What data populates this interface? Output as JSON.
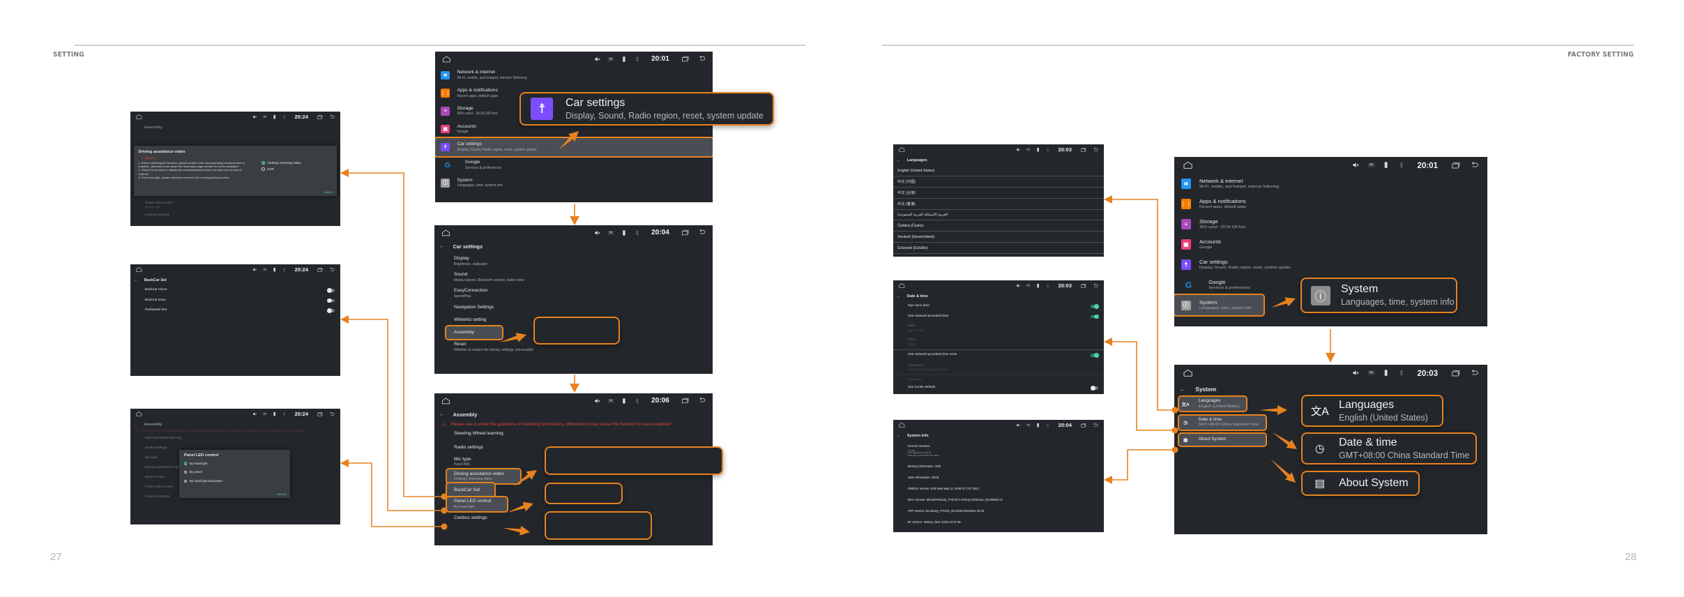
{
  "page_left": {
    "section": "SETTING",
    "page_number": "27"
  },
  "page_right": {
    "section": "FACTORY SETTING",
    "page_number": "28"
  },
  "accent_color": "#e8821e",
  "settings_items": [
    {
      "title": "Network & internet",
      "subtitle": "Wi-Fi, mobile, and hotspot, internet Tethering",
      "icon": "wifi-icon",
      "color": "#2196f3"
    },
    {
      "title": "Apps & notifications",
      "subtitle": "Recent apps, default apps",
      "icon": "apps-grid-icon",
      "color": "#f57c00"
    },
    {
      "title": "Storage",
      "subtitle": "36% used - 20.55 GB free",
      "icon": "storage-icon",
      "color": "#ab47bc"
    },
    {
      "title": "Accounts",
      "subtitle": "Google",
      "icon": "account-icon",
      "color": "#ec407a"
    },
    {
      "title": "Car settings",
      "subtitle": "Display, Sound, Radio region, reset, system update",
      "icon": "accessibility-icon",
      "color": "#7c4dff"
    },
    {
      "title": "Google",
      "subtitle": "Services & preferences",
      "icon": "google-icon",
      "color": "#1e88e5"
    },
    {
      "title": "System",
      "subtitle": "Languages, time, system info",
      "icon": "info-icon",
      "color": "#9e9e9e"
    }
  ],
  "screens": {
    "main_left": {
      "time": "20:01"
    },
    "car_settings": {
      "time": "20:04",
      "title": "Car settings",
      "items": [
        {
          "title": "Display",
          "subtitle": "Brightness, wallpaper"
        },
        {
          "title": "Sound",
          "subtitle": "Media volume, Bluetooth volume, button tone"
        },
        {
          "title": "EasyConnection",
          "subtitle": "SpeedPlay"
        },
        {
          "title": "Navigation Settings",
          "subtitle": ""
        },
        {
          "title": "Whitelist setting",
          "subtitle": ""
        },
        {
          "title": "Assembly",
          "subtitle": ""
        },
        {
          "title": "Reset",
          "subtitle": "Whether to restore the factory settings, irrevocable!"
        }
      ]
    },
    "assembly": {
      "time": "20:06",
      "title": "Assembly",
      "warning": "Please use it under the guidance of installing technicians, otherwise it may cause the function to use exception!",
      "items": [
        {
          "title": "Steering Wheel learning",
          "subtitle": ""
        },
        {
          "title": "Radio settings",
          "subtitle": ""
        },
        {
          "title": "Mic type",
          "subtitle": "Panel MIC"
        },
        {
          "title": "Driving assistance video",
          "subtitle": "Ordinary reversing video"
        },
        {
          "title": "BackCar Set",
          "subtitle": ""
        },
        {
          "title": "Panel LED control",
          "subtitle": "By head light"
        },
        {
          "title": "Canbus settings",
          "subtitle": ""
        }
      ]
    },
    "driving_video": {
      "time": "20:24",
      "bg_title": "Assembly",
      "bg_items": [
        {
          "title": "Panel LED control",
          "subtitle": "By head light"
        },
        {
          "title": "Canbus settings",
          "subtitle": ""
        }
      ],
      "dialog_title": "Driving assistance video",
      "warning_label": "Warning",
      "lines": [
        "1. Before selecting the function, please confirm if the corresponding functional item is installed, otherwise it will cause the reversing image function to not be available!",
        "2. Select the function to display the corresponding function icon after the function is entered.",
        "3. If the lens type, please select the screen in the corresponding function."
      ],
      "options": [
        {
          "label": "Ordinary reversing video",
          "selected": true
        },
        {
          "label": "DVR",
          "selected": false
        }
      ],
      "cancel": "CANCEL"
    },
    "backcar": {
      "time": "20:24",
      "title": "BackCar Set",
      "toggles": [
        {
          "label": "Backcar mirror",
          "on": false
        },
        {
          "label": "Backcar trace",
          "on": false
        },
        {
          "label": "Parkassist line",
          "on": false
        }
      ]
    },
    "panel_led": {
      "time": "20:24",
      "bg_title": "Assembly",
      "bg_items": [
        "Steering Wheel learning",
        "Radio settings",
        "Mic type",
        "Driving assistance video",
        "BackCar Set",
        "Panel LED control",
        "Canbus settings"
      ],
      "dialog_title": "Panel LED control",
      "options": [
        {
          "label": "By head light",
          "selected": true
        },
        {
          "label": "By power",
          "selected": false
        },
        {
          "label": "By head light and power",
          "selected": false
        }
      ],
      "cancel": "CANCEL"
    },
    "languages": {
      "time": "20:03",
      "title": "Languages",
      "items": [
        "English (United States)",
        "中文 (中国)",
        "中文 (台灣)",
        "中文 (香港)",
        "العربية (المملكة العربية السعودية)",
        "Čeština (Česko)",
        "Deutsch (Deutschland)",
        "Ελληνικά (Ελλάδα)"
      ]
    },
    "date_time": {
      "time": "20:03",
      "title": "Date & time",
      "rows": [
        {
          "title": "Gps sync time",
          "subtitle": "",
          "toggle": "on",
          "dim": false
        },
        {
          "title": "Use network-provided time",
          "subtitle": "",
          "toggle": "on",
          "dim": false
        },
        {
          "title": "Date",
          "subtitle": "May 11, 2022",
          "toggle": "",
          "dim": true
        },
        {
          "title": "Time",
          "subtitle": "20:03",
          "toggle": "",
          "dim": true
        },
        {
          "title": "Use network-provided time zone",
          "subtitle": "",
          "toggle": "on",
          "dim": false
        },
        {
          "title": "Time zone",
          "subtitle": "GMT+08:00 China Standard Time",
          "toggle": "",
          "dim": true
        },
        {
          "title": "TIME FORMAT",
          "subtitle": "",
          "toggle": "",
          "dim": true
        },
        {
          "title": "Use locale default",
          "subtitle": "",
          "toggle": "off",
          "dim": false
        }
      ]
    },
    "system_info": {
      "time": "20:04",
      "title": "System info",
      "kernel_label": "Kernel Version",
      "kernel_lines": [
        "4.9.118",
        "zbmrek@ubuntu 295 #1",
        "Wed May 11 19:39:48 CST 2022"
      ],
      "rows": [
        "Memory information:  2GB",
        "Store information:  32GB",
        "Platform Version:  K3S-Wed May 11 19:59:37 CST 2022",
        "MCU Version:  MCU8F#2611Q_FYD-BTL-6761Q-20220112_M140BW2.01",
        "APP Version:  DC2611Q_FYD2N_3212408-20220511.20.00",
        "BT Version:  XD816_2021-10/23 12:37:36",
        "SN:  6878482052208015"
      ]
    },
    "main_right": {
      "time": "20:01"
    },
    "system": {
      "time": "20:03",
      "title": "System",
      "items": [
        {
          "title": "Languages",
          "subtitle": "English (United States)",
          "icon": "translate-icon"
        },
        {
          "title": "Date & time",
          "subtitle": "GMT+08:00 China Standard Time",
          "icon": "clock-icon"
        },
        {
          "title": "About System",
          "subtitle": "",
          "icon": "phone-info-icon"
        }
      ]
    }
  },
  "callouts": {
    "car_settings": {
      "title": "Car settings",
      "subtitle": "Display, Sound, Radio region, reset, system update"
    },
    "system": {
      "title": "System",
      "subtitle": "Languages, time, system info"
    },
    "languages": {
      "title": "Languages",
      "subtitle": "English (United States)"
    },
    "date_time": {
      "title": "Date & time",
      "subtitle": "GMT+08:00 China Standard Time"
    },
    "about": {
      "title": "About System"
    }
  }
}
